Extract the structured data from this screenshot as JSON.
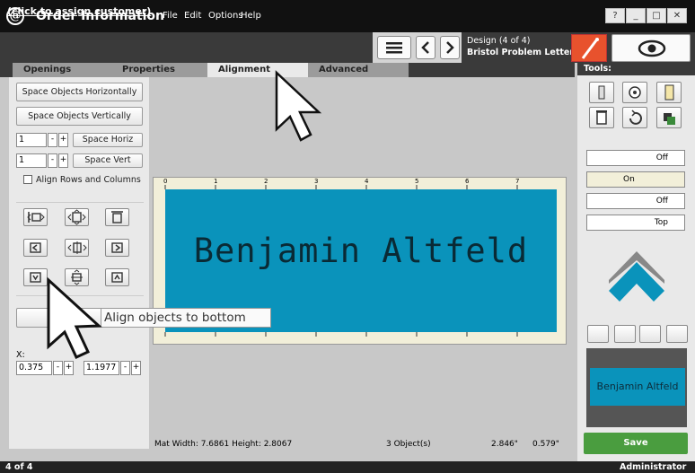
{
  "app": {
    "title": "Order Information",
    "logo": "@",
    "menu": [
      "File",
      "Edit",
      "Options",
      "Help"
    ],
    "window_buttons": [
      "?",
      "_",
      "□",
      "✕"
    ]
  },
  "customer": {
    "assign_link": "(click to assign customer)"
  },
  "design": {
    "label": "Design  (4 of 4)",
    "name": "Bristol Problem Letters"
  },
  "tabs": [
    "Openings",
    "Properties",
    "Alignment",
    "Advanced"
  ],
  "active_tab": "Alignment",
  "left": {
    "space_h_btn": "Space Objects Horizontally",
    "space_v_btn": "Space Objects Vertically",
    "space_horiz": {
      "value": "1",
      "label": "Space Horiz"
    },
    "space_vert": {
      "value": "1",
      "label": "Space Vert"
    },
    "align_rows_cols": "Align Rows and Columns",
    "x_label": "X:",
    "x_value": "0.375",
    "y_value": "1.1977"
  },
  "canvas": {
    "nameplate_text": "Benjamin Altfeld",
    "ruler_top": [
      "0",
      "1",
      "2",
      "3",
      "4",
      "5",
      "6",
      "7"
    ],
    "tooltip": "Align objects to bottom"
  },
  "status": {
    "mat": "Mat  Width: 7.6861  Height: 2.8067",
    "objects": "3 Object(s)",
    "x": "2.846\"",
    "y": "0.579\""
  },
  "tools": {
    "header": "Tools:",
    "toggles": [
      {
        "state": "Off"
      },
      {
        "state": "On"
      },
      {
        "state": "Off"
      },
      {
        "state": "Top"
      }
    ],
    "preview_text": "Benjamin Altfeld",
    "save": "Save"
  },
  "footer": {
    "page": "4 of 4",
    "user": "Administrator"
  },
  "colors": {
    "plate": "#0a93bb",
    "save": "#4a9d3f",
    "accent": "#e8522d"
  }
}
